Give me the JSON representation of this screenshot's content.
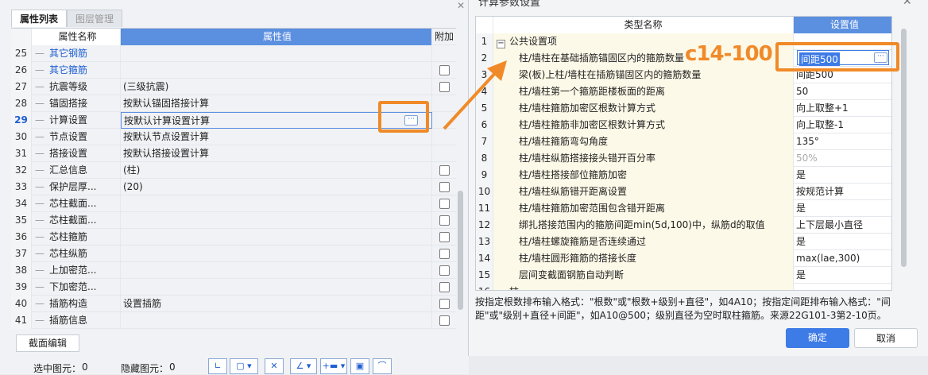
{
  "left_panel": {
    "tabs": [
      "属性列表",
      "图层管理"
    ],
    "headers": {
      "name": "属性名称",
      "value": "属性值",
      "add": "附加"
    },
    "rows": [
      {
        "num": "25",
        "name": "其它钢筋",
        "value": "",
        "check": false,
        "blue": true
      },
      {
        "num": "26",
        "name": "其它箍筋",
        "value": "",
        "check": true,
        "blue": true
      },
      {
        "num": "27",
        "name": "抗震等级",
        "value": "(三级抗震)",
        "check": true
      },
      {
        "num": "28",
        "name": "锚固搭接",
        "value": "按默认锚固搭接计算",
        "check": false
      },
      {
        "num": "29",
        "name": "计算设置",
        "value": "按默认计算设置计算",
        "check": false,
        "selected": true
      },
      {
        "num": "30",
        "name": "节点设置",
        "value": "按默认节点设置计算",
        "check": false
      },
      {
        "num": "31",
        "name": "搭接设置",
        "value": "按默认搭接设置计算",
        "check": false
      },
      {
        "num": "32",
        "name": "汇总信息",
        "value": "(柱)",
        "check": true
      },
      {
        "num": "33",
        "name": "保护层厚...",
        "value": "(20)",
        "check": true
      },
      {
        "num": "34",
        "name": "芯柱截面...",
        "value": "",
        "check": true
      },
      {
        "num": "35",
        "name": "芯柱截面...",
        "value": "",
        "check": true
      },
      {
        "num": "36",
        "name": "芯柱箍筋",
        "value": "",
        "check": true
      },
      {
        "num": "37",
        "name": "芯柱纵筋",
        "value": "",
        "check": true
      },
      {
        "num": "38",
        "name": "上加密范...",
        "value": "",
        "check": true
      },
      {
        "num": "39",
        "name": "下加密范...",
        "value": "",
        "check": true
      },
      {
        "num": "40",
        "name": "插筋构造",
        "value": "设置插筋",
        "check": true
      },
      {
        "num": "41",
        "name": "插筋信息",
        "value": "",
        "check": true
      }
    ],
    "section_button": "截面编辑",
    "status": {
      "selected_label": "选中图元：",
      "selected_count": "0",
      "hidden_label": "隐藏图元：",
      "hidden_count": "0"
    }
  },
  "dialog": {
    "title": "计算参数设置",
    "headers": {
      "type": "类型名称",
      "value": "设置值"
    },
    "rows": [
      {
        "num": "1",
        "name": "公共设置项",
        "value": "",
        "group": true
      },
      {
        "num": "2",
        "name": "柱/墙柱在基础插筋锚固区内的箍筋数量",
        "value": "间距500",
        "selected": true
      },
      {
        "num": "3",
        "name": "梁(板)上柱/墙柱在插筋锚固区内的箍筋数量",
        "value": "间距500"
      },
      {
        "num": "4",
        "name": "柱/墙柱第一个箍筋距楼板面的距离",
        "value": "50"
      },
      {
        "num": "5",
        "name": "柱/墙柱箍筋加密区根数计算方式",
        "value": "向上取整+1"
      },
      {
        "num": "6",
        "name": "柱/墙柱箍筋非加密区根数计算方式",
        "value": "向上取整-1"
      },
      {
        "num": "7",
        "name": "柱/墙柱箍筋弯勾角度",
        "value": "135°"
      },
      {
        "num": "8",
        "name": "柱/墙柱纵筋搭接接头错开百分率",
        "value": "50%",
        "gray": true
      },
      {
        "num": "9",
        "name": "柱/墙柱搭接部位箍筋加密",
        "value": "是"
      },
      {
        "num": "10",
        "name": "柱/墙柱纵筋错开距离设置",
        "value": "按规范计算"
      },
      {
        "num": "11",
        "name": "柱/墙柱箍筋加密范围包含错开距离",
        "value": "是"
      },
      {
        "num": "12",
        "name": "绑扎搭接范围内的箍筋间距min(5d,100)中，纵筋d的取值",
        "value": "上下层最小直径"
      },
      {
        "num": "13",
        "name": "柱/墙柱螺旋箍筋是否连续通过",
        "value": "是"
      },
      {
        "num": "14",
        "name": "柱/墙柱圆形箍筋的搭接长度",
        "value": "max(lae,300)"
      },
      {
        "num": "15",
        "name": "层间变截面钢筋自动判断",
        "value": "是"
      },
      {
        "num": "16",
        "name": "柱",
        "value": "",
        "group": true
      }
    ],
    "hint": "按指定根数排布输入格式：\"根数\"或\"根数+级别+直径\"，如4A10；按指定间距排布输入格式：\"间距\"或\"级别+直径+间距\"，如A10@500；级别直径为空时取柱箍筋。来源22G101-3第2-10页。",
    "ok": "确定",
    "cancel": "取消"
  },
  "annotation": {
    "text": "c14-100",
    "color": "#f08a28"
  },
  "colors": {
    "accent": "#5b8fe0",
    "orange": "#f08a28",
    "link": "#1f5fd1"
  }
}
